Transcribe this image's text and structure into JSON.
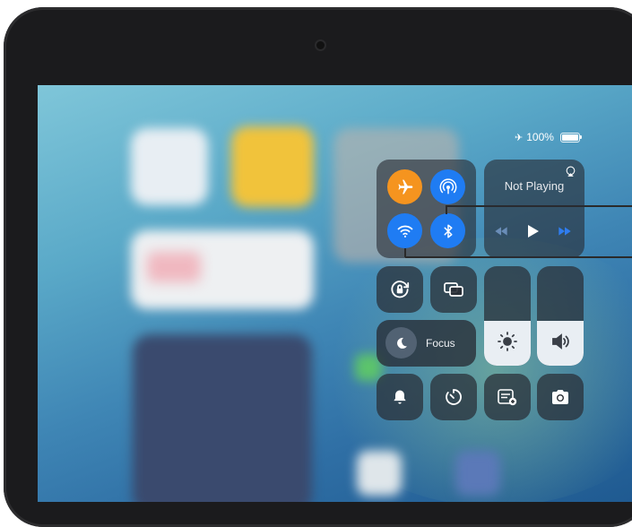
{
  "status_bar": {
    "battery_text": "100%"
  },
  "control_center": {
    "connectivity": {
      "airplane": {
        "icon": "airplane-icon",
        "color": "#f5941f",
        "active": true
      },
      "airdrop": {
        "icon": "airdrop-icon",
        "color": "#1f7cf3",
        "active": true
      },
      "wifi": {
        "icon": "wifi-icon",
        "color": "#1f7cf3",
        "active": true
      },
      "bluetooth": {
        "icon": "bluetooth-icon",
        "color": "#1f7cf3",
        "active": true
      }
    },
    "now_playing": {
      "title": "Not Playing",
      "icons": [
        "airplay-icon",
        "rewind-icon",
        "play-icon",
        "fast-forward-icon"
      ]
    },
    "toggles": [
      {
        "name": "orientation-lock",
        "icon": "rotation-lock-icon"
      },
      {
        "name": "screen-mirroring",
        "icon": "screen-mirroring-icon"
      }
    ],
    "focus": {
      "label": "Focus",
      "icon": "moon-icon"
    },
    "brightness": {
      "icon": "sun-icon",
      "level": 0.45
    },
    "volume": {
      "icon": "speaker-icon",
      "level": 0.45
    },
    "bottom_row": [
      {
        "name": "silent-mode",
        "icon": "bell-icon"
      },
      {
        "name": "timer",
        "icon": "timer-icon"
      },
      {
        "name": "quick-note",
        "icon": "note-add-icon"
      },
      {
        "name": "camera",
        "icon": "camera-icon"
      }
    ]
  }
}
